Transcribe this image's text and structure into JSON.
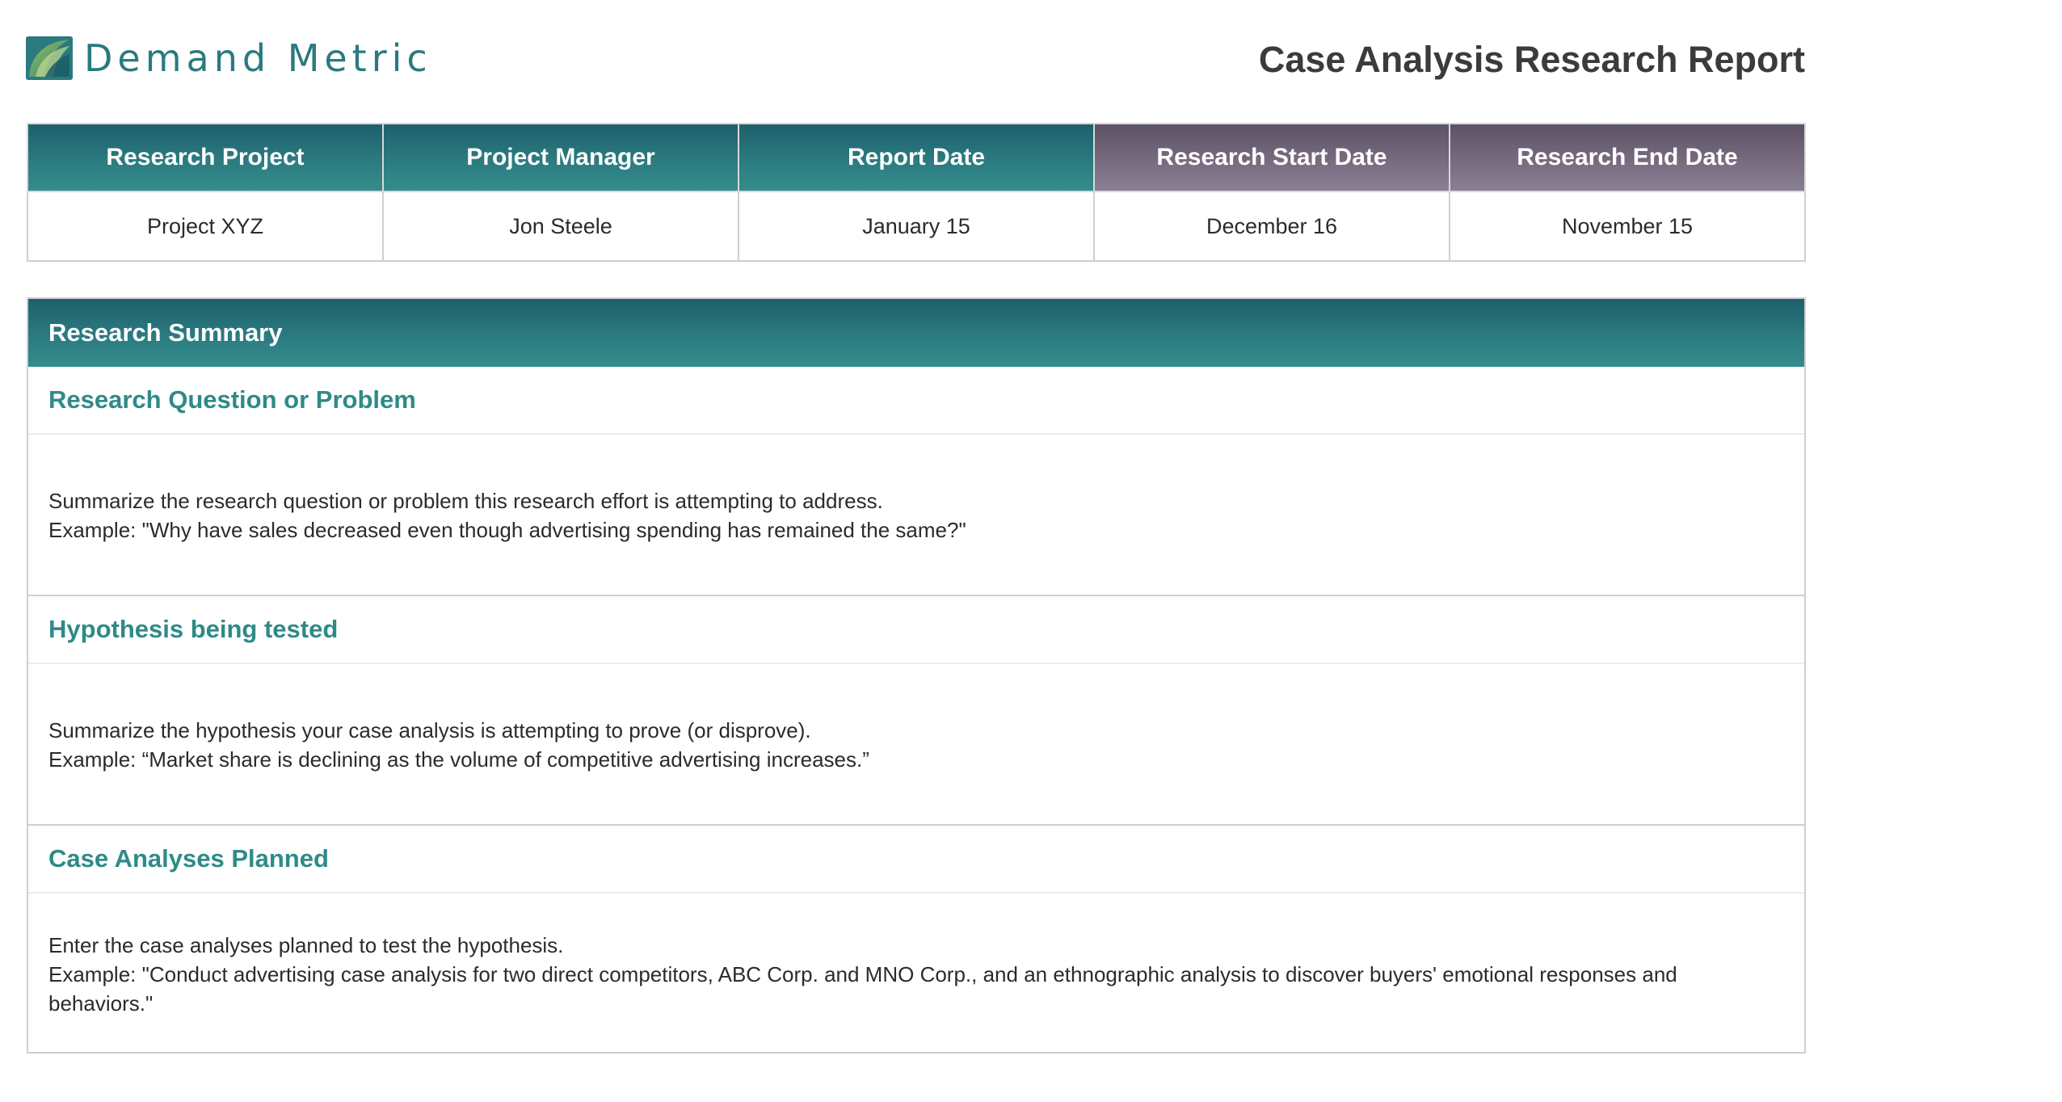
{
  "brand": {
    "name": "Demand Metric"
  },
  "report": {
    "title": "Case Analysis Research Report"
  },
  "info": {
    "headers": [
      "Research Project",
      "Project Manager",
      "Report Date",
      "Research Start Date",
      "Research End Date"
    ],
    "values": [
      "Project XYZ",
      "Jon Steele",
      "January 15",
      "December 16",
      "November 15"
    ]
  },
  "summary": {
    "title": "Research Summary",
    "sections": [
      {
        "title": "Research Question or Problem",
        "lines": [
          "Summarize the research question or problem this research effort is attempting to address.",
          "Example:  \"Why have sales decreased even though advertising spending has remained the same?\""
        ]
      },
      {
        "title": "Hypothesis being tested",
        "lines": [
          "Summarize the hypothesis your case analysis is attempting to prove (or disprove).",
          "Example:  “Market share is declining as the volume of competitive advertising increases.”"
        ]
      },
      {
        "title": "Case Analyses Planned",
        "lines": [
          "Enter the case analyses planned to test the hypothesis.",
          "Example: \"Conduct advertising case analysis for two direct competitors, ABC Corp. and MNO Corp., and an ethnographic analysis to discover buyers' emotional responses and behaviors.\""
        ]
      }
    ]
  },
  "colors": {
    "teal": "#2b7b80",
    "mauve": "#776b80",
    "section_title": "#2e8a88",
    "title_text": "#3b3b3b"
  },
  "icons": {
    "logo": "demand-metric-logo-icon"
  }
}
